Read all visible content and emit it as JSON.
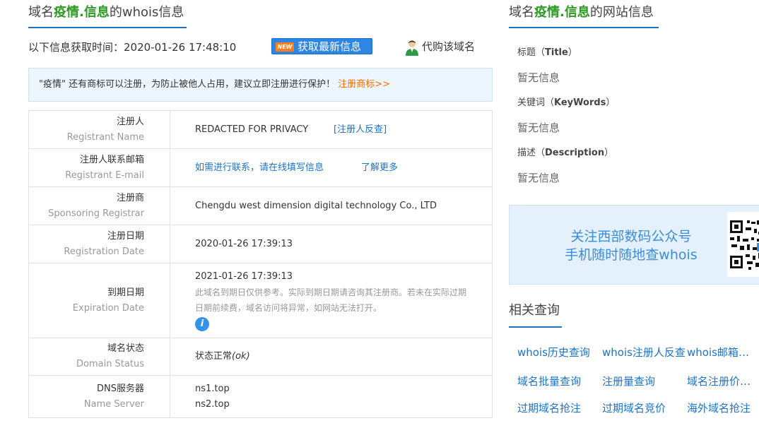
{
  "whois": {
    "title_prefix": "域名",
    "domain": "疫情.信息",
    "title_suffix": "的whois信息"
  },
  "info_bar": {
    "time_label": "以下信息获取时间：2020-01-26 17:48:10",
    "new_badge": "NEW",
    "fetch_button": "获取最新信息",
    "agent_label": "代购该域名"
  },
  "notice": {
    "text": "\"疫情\" 还有商标可以注册，为防止被他人占用，建议立即注册进行保护！",
    "link": "注册商标>>"
  },
  "table": {
    "registrant": {
      "cn": "注册人",
      "en": "Registrant Name",
      "value": "REDACTED FOR PRIVACY",
      "link": "[注册人反查]"
    },
    "email": {
      "cn": "注册人联系邮箱",
      "en": "Registrant E-mail",
      "link1": "如需进行联系，请在线填写信息",
      "link2": "了解更多"
    },
    "registrar": {
      "cn": "注册商",
      "en": "Sponsoring Registrar",
      "value": "Chengdu west dimension digital technology Co., LTD"
    },
    "reg_date": {
      "cn": "注册日期",
      "en": "Registration Date",
      "value": "2020-01-26 17:39:13"
    },
    "exp_date": {
      "cn": "到期日期",
      "en": "Expiration Date",
      "value": "2021-01-26 17:39:13",
      "note": "此域名到期日仅供参考。实际到期日期请咨询其注册商。若未在实际过期日期前续费，域名访问将异常，如网站无法打开。",
      "icon": "i"
    },
    "status": {
      "cn": "域名状态",
      "en": "Domain Status",
      "value": "状态正常",
      "value_code": "(ok)"
    },
    "dns": {
      "cn": "DNS服务器",
      "en": "Name Server",
      "ns1": "ns1.top",
      "ns2": "ns2.top"
    }
  },
  "site": {
    "title_prefix": "域名",
    "domain": "疫情.信息",
    "title_suffix": "的网站信息",
    "title_key": "标题（",
    "title_key_en": "Title",
    "title_close": "）",
    "title_val": "暂无信息",
    "kw_key": "关键词（",
    "kw_key_en": "KeyWords",
    "kw_close": "）",
    "kw_val": "暂无信息",
    "desc_key": "描述（",
    "desc_key_en": "Description",
    "desc_close": "）",
    "desc_val": "暂无信息"
  },
  "banner": {
    "line1": "关注西部数码公众号",
    "line2": "手机随时随地查whois"
  },
  "related": {
    "title": "相关查询",
    "items": [
      "whois历史查询",
      "whois注册人反查",
      "whois邮箱反查",
      "域名批量查询",
      "注册量查询",
      "域名注册价格查询",
      "过期域名抢注",
      "过期域名竞价",
      "海外域名抢注"
    ]
  },
  "colors": {
    "accent_blue": "#1b73c7",
    "highlight_green": "#2e9a23",
    "orange_link": "#ff6a00"
  }
}
